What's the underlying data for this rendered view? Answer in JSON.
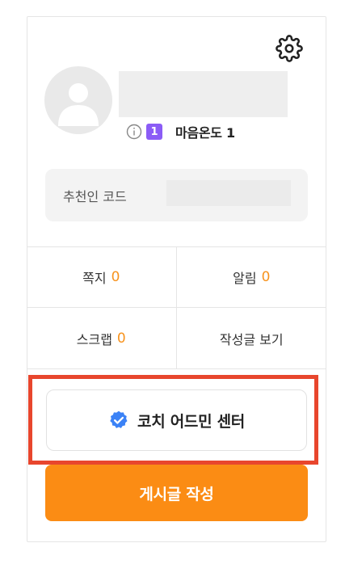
{
  "profile": {
    "level": "1",
    "temperature_label": "마음온도 1"
  },
  "referral": {
    "label": "추천인 코드"
  },
  "stats": {
    "messages": {
      "label": "쪽지",
      "count": "0"
    },
    "notifications": {
      "label": "알림",
      "count": "0"
    },
    "scraps": {
      "label": "스크랩",
      "count": "0"
    },
    "my_posts": {
      "label": "작성글 보기"
    }
  },
  "actions": {
    "coach_admin_label": "코치 어드민 센터",
    "write_post_label": "게시글 작성"
  },
  "colors": {
    "accent_orange": "#fb8c14",
    "count_orange": "#f7931e",
    "level_purple": "#8b5cf6",
    "verified_blue": "#3b82f6",
    "highlight_red": "#e8462d"
  },
  "icons": {
    "settings": "gear-icon",
    "info": "info-icon",
    "verified": "verified-check-icon",
    "avatar": "user-silhouette-icon"
  }
}
